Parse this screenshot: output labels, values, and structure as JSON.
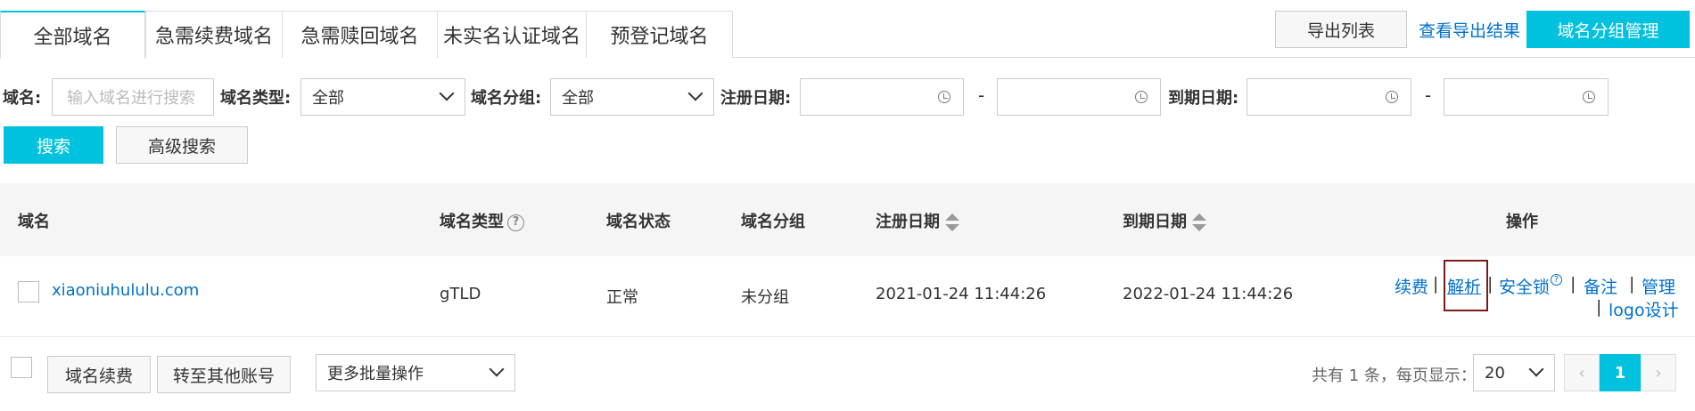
{
  "tabs": [
    "全部域名",
    "急需续费域名",
    "急需赎回域名",
    "未实名认证域名",
    "预登记域名"
  ],
  "toolbar": {
    "export_list": "导出列表",
    "view_export": "查看导出结果",
    "group_manage": "域名分组管理"
  },
  "filters": {
    "domain_label": "域名:",
    "domain_placeholder": "输入域名进行搜索",
    "type_label": "域名类型:",
    "type_value": "全部",
    "group_label": "域名分组:",
    "group_value": "全部",
    "reg_date_label": "注册日期:",
    "expire_date_label": "到期日期:",
    "range_sep": "-",
    "search": "搜索",
    "advanced_search": "高级搜索"
  },
  "table": {
    "headers": {
      "domain": "域名",
      "type": "域名类型",
      "status": "域名状态",
      "group": "域名分组",
      "reg_date": "注册日期",
      "expire_date": "到期日期",
      "actions": "操作"
    },
    "rows": [
      {
        "domain": "xiaoniuhululu.com",
        "type": "gTLD",
        "status": "正常",
        "group": "未分组",
        "reg_date": "2021-01-24 11:44:26",
        "expire_date": "2022-01-24 11:44:26"
      }
    ],
    "actions": {
      "renew": "续费",
      "resolve": "解析",
      "security_lock": "安全锁",
      "note": "备注",
      "manage": "管理",
      "logo_design": "logo设计",
      "sep": "|"
    },
    "highlight_color": "#7a1a1a"
  },
  "footer": {
    "renew": "域名续费",
    "transfer": "转至其他账号",
    "batch": "更多批量操作",
    "total_text": "共有 1 条，每页显示：",
    "page_size": "20",
    "prev": "‹",
    "current_page": "1",
    "next": "›"
  },
  "colors": {
    "accent": "#00c1de",
    "link": "#0070cc"
  }
}
